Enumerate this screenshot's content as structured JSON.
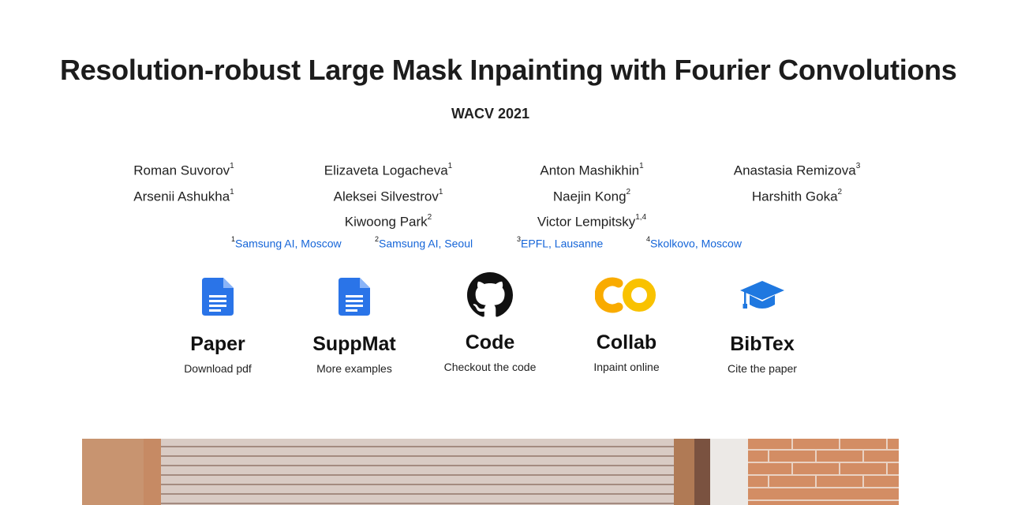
{
  "title": "Resolution-robust Large Mask Inpainting with Fourier Convolutions",
  "venue": "WACV 2021",
  "author_columns": [
    [
      {
        "name": "Roman Suvorov",
        "sup": "1"
      },
      {
        "name": "Arsenii Ashukha",
        "sup": "1"
      }
    ],
    [
      {
        "name": "Elizaveta Logacheva",
        "sup": "1"
      },
      {
        "name": "Aleksei Silvestrov",
        "sup": "1"
      },
      {
        "name": "Kiwoong Park",
        "sup": "2"
      }
    ],
    [
      {
        "name": "Anton Mashikhin",
        "sup": "1"
      },
      {
        "name": "Naejin Kong",
        "sup": "2"
      },
      {
        "name": "Victor Lempitsky",
        "sup": "1,4"
      }
    ],
    [
      {
        "name": "Anastasia Remizova",
        "sup": "3"
      },
      {
        "name": "Harshith Goka",
        "sup": "2"
      }
    ]
  ],
  "affiliations": [
    {
      "sup": "1",
      "label": "Samsung AI, Moscow"
    },
    {
      "sup": "2",
      "label": "Samsung AI, Seoul"
    },
    {
      "sup": "3",
      "label": "EPFL, Lausanne"
    },
    {
      "sup": "4",
      "label": "Skolkovo, Moscow"
    }
  ],
  "links": [
    {
      "icon": "document-icon",
      "title": "Paper",
      "subtitle": "Download pdf"
    },
    {
      "icon": "document-icon",
      "title": "SuppMat",
      "subtitle": "More examples"
    },
    {
      "icon": "github-icon",
      "title": "Code",
      "subtitle": "Checkout the code"
    },
    {
      "icon": "colab-icon",
      "title": "Collab",
      "subtitle": "Inpaint online"
    },
    {
      "icon": "graduation-cap-icon",
      "title": "BibTex",
      "subtitle": "Cite the paper"
    }
  ],
  "colors": {
    "link": "#1565d8",
    "doc_icon": "#2a74e8",
    "colab_icon": "#f9ab00",
    "cap_icon": "#1f78e0"
  }
}
